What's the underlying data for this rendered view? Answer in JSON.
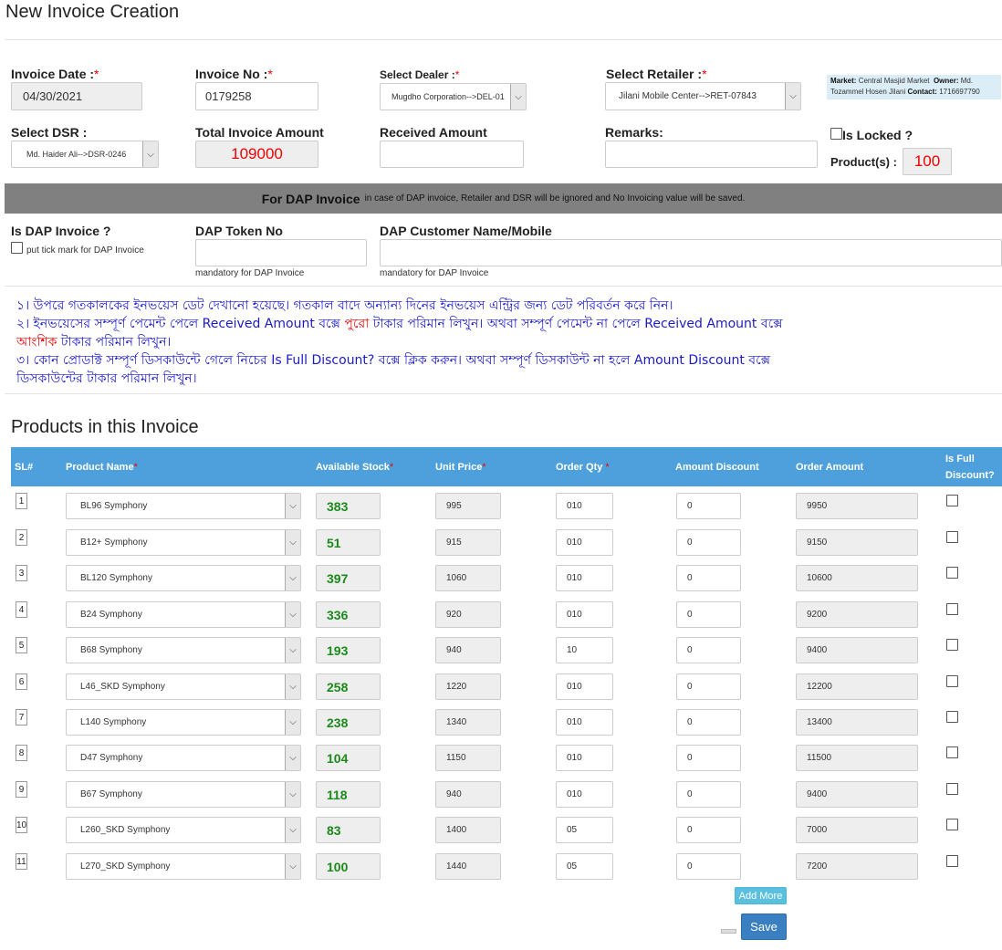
{
  "page": {
    "title": "New Invoice Creation"
  },
  "form": {
    "invoice_date_label": "Invoice Date :",
    "invoice_date": "04/30/2021",
    "invoice_no_label": "Invoice No :",
    "invoice_no": "0179258",
    "dealer_label": "Select Dealer :",
    "dealer_value": "Mugdho Corporation-->DEL-01",
    "retailer_label": "Select Retailer :",
    "retailer_value": "Jilani Mobile Center-->RET-07843",
    "market_key": "Market:",
    "market_value": "Central Masjid Market",
    "owner_key": "Owner:",
    "owner_value": "Md. Tozammel Hosen Jilani",
    "contact_key": "Contact:",
    "contact_value": "1716697790",
    "dsr_label": "Select DSR :",
    "dsr_value": "Md. Haider Ali-->DSR-0246",
    "total_label": "Total Invoice Amount",
    "total_value": "109000",
    "received_label": "Received Amount",
    "received_value": "",
    "remarks_label": "Remarks:",
    "remarks_value": "",
    "locked_label": "Is Locked ?",
    "products_label": "Product(s) :",
    "products_count": "100",
    "required_mark": "*"
  },
  "dap": {
    "bar_title": "For DAP Invoice",
    "bar_note": "in case of DAP invoice, Retailer and DSR will be ignored and No Invoicing value will be saved.",
    "is_dap_label": "Is DAP Invoice ?",
    "tick_hint": "put tick mark for DAP Invoice",
    "token_label": "DAP Token No",
    "token_hint": "mandatory for DAP Invoice",
    "customer_label": "DAP Customer Name/Mobile",
    "customer_hint": "mandatory for DAP Invoice"
  },
  "notice": {
    "line1": "১। উপরে গতকালকের ইনভয়েস ডেট দেখানো হয়েছে। গতকাল বাদে অন্যান্য দিনের ইনভয়েস এন্ট্রির জন্য ডেট পরিবর্তন করে নিন।",
    "line2a": "২। ইনভয়েসের সম্পূর্ণ পেমেন্ট পেলে Received Amount বক্সে",
    "line2_red1": "পুরো",
    "line2b": "টাকার পরিমান লিখুন। অথবা সম্পূর্ণ পেমেন্ট না পেলে Received Amount বক্সে",
    "line2_red2": "আংশিক",
    "line2c": "টাকার পরিমান লিখুন।",
    "line3": "৩। কোন প্রোডাক্ট সম্পূর্ণ ডিসকাউন্টে গেলে নিচের Is Full Discount? বক্সে ক্লিক করুন। অথবা সম্পূর্ণ ডিসকাউন্ট না হলে Amount Discount বক্সে ডিসকাউন্টের টাকার পরিমান লিখুন।"
  },
  "products": {
    "title": "Products in this Invoice",
    "headers": {
      "sl": "SL#",
      "product": "Product Name",
      "stock": "Available Stock",
      "unit_price": "Unit Price",
      "order_qty": "Order Qty",
      "amount_discount": "Amount Discount",
      "order_amount": "Order Amount",
      "full_discount": "Is Full Discount?"
    },
    "rows": [
      {
        "sl": "1",
        "product": "BL96 Symphony",
        "stock": "383",
        "price": "995",
        "qty": "010",
        "discount": "0",
        "amount": "9950"
      },
      {
        "sl": "2",
        "product": "B12+ Symphony",
        "stock": "51",
        "price": "915",
        "qty": "010",
        "discount": "0",
        "amount": "9150"
      },
      {
        "sl": "3",
        "product": "BL120 Symphony",
        "stock": "397",
        "price": "1060",
        "qty": "010",
        "discount": "0",
        "amount": "10600"
      },
      {
        "sl": "4",
        "product": "B24 Symphony",
        "stock": "336",
        "price": "920",
        "qty": "010",
        "discount": "0",
        "amount": "9200"
      },
      {
        "sl": "5",
        "product": "B68 Symphony",
        "stock": "193",
        "price": "940",
        "qty": "10",
        "discount": "0",
        "amount": "9400"
      },
      {
        "sl": "6",
        "product": "L46_SKD Symphony",
        "stock": "258",
        "price": "1220",
        "qty": "010",
        "discount": "0",
        "amount": "12200"
      },
      {
        "sl": "7",
        "product": "L140 Symphony",
        "stock": "238",
        "price": "1340",
        "qty": "010",
        "discount": "0",
        "amount": "13400"
      },
      {
        "sl": "8",
        "product": "D47 Symphony",
        "stock": "104",
        "price": "1150",
        "qty": "010",
        "discount": "0",
        "amount": "11500"
      },
      {
        "sl": "9",
        "product": "B67 Symphony",
        "stock": "118",
        "price": "940",
        "qty": "010",
        "discount": "0",
        "amount": "9400"
      },
      {
        "sl": "10",
        "product": "L260_SKD Symphony",
        "stock": "83",
        "price": "1400",
        "qty": "05",
        "discount": "0",
        "amount": "7000"
      },
      {
        "sl": "11",
        "product": "L270_SKD Symphony",
        "stock": "100",
        "price": "1440",
        "qty": "05",
        "discount": "0",
        "amount": "7200"
      }
    ]
  },
  "buttons": {
    "add_more": "Add More",
    "save": "Save"
  },
  "icons": {
    "dropdown": "chevron-down-icon"
  },
  "colors": {
    "header_blue": "#4ea0dc",
    "stock_green": "#1a8a1a",
    "required_red": "#e00000",
    "notice_blue": "#1a1acc",
    "dap_bar_gray": "#808080"
  }
}
